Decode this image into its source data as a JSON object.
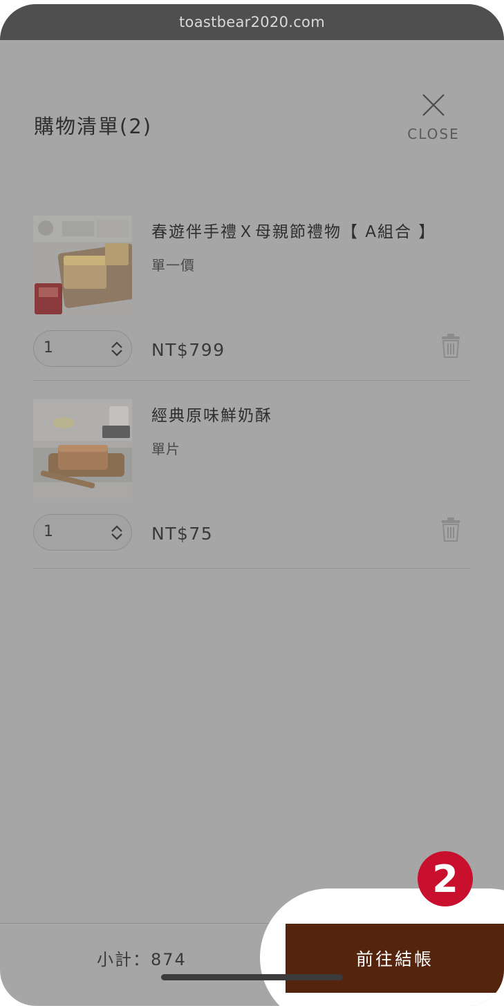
{
  "browser": {
    "url": "toastbear2020.com"
  },
  "cart": {
    "title": "購物清單(2)",
    "close_label": "CLOSE",
    "items": [
      {
        "name": "春遊伴手禮Ｘ母親節禮物【 A組合 】",
        "variant": "單一價",
        "quantity": "1",
        "price": "NT$799"
      },
      {
        "name": "經典原味鮮奶酥",
        "variant": "單片",
        "quantity": "1",
        "price": "NT$75"
      }
    ],
    "subtotal": "小計：874",
    "checkout_label": "前往結帳",
    "step_badge": "2"
  },
  "icons": {
    "close": "close-icon",
    "quantity": "chevron-up-down-icon",
    "delete": "trash-icon"
  },
  "colors": {
    "checkout": "#55240d",
    "step_badge": "#c8102e",
    "url_bar": "#4e4f4e"
  }
}
